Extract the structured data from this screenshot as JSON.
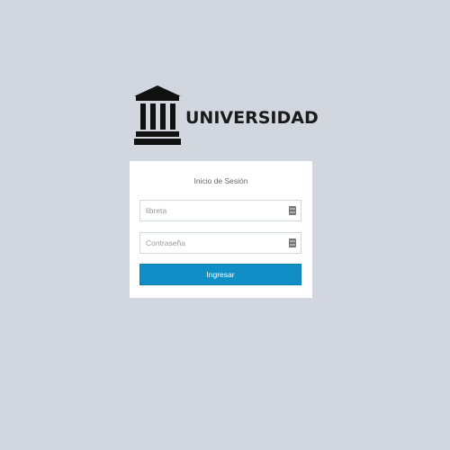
{
  "brand": {
    "logo_text": "UNIVERSIDAD",
    "logo_icon": "university-building-icon"
  },
  "login": {
    "title": "Inicio de Sesión",
    "username_placeholder": "libreta",
    "username_value": "",
    "password_placeholder": "Contraseña",
    "password_value": "",
    "submit_label": "Ingresar",
    "username_icon": "id-card-icon",
    "password_icon": "lock-icon"
  },
  "colors": {
    "page_background": "#d2d6de",
    "box_background": "#ffffff",
    "primary_button": "#0f8fc6",
    "logo_color": "#1a1a1a"
  }
}
